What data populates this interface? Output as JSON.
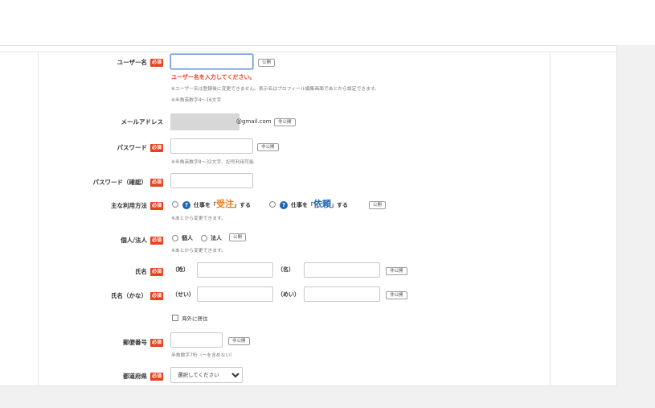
{
  "form": {
    "username": {
      "label": "ユーザー名",
      "required": "必須",
      "value": "",
      "public_tag": "公開",
      "error": "ユーザー名を入力してください。",
      "note1": "※ユーザー名は登録後に変更できません。表示名はプロフィール編集画面であとから設定できます。",
      "note2": "※半角英数字4～16文字"
    },
    "email": {
      "label": "メールアドレス",
      "suffix": "@gmail.com",
      "private_tag": "非公開"
    },
    "password": {
      "label": "パスワード",
      "required": "必須",
      "value": "",
      "private_tag": "非公開",
      "note": "※半角英数字8～32文字、記号利用可能"
    },
    "password_confirm": {
      "label": "パスワード（確認）",
      "required": "必須",
      "value": ""
    },
    "usage": {
      "label": "主な利用方法",
      "required": "必須",
      "opt1_pre": "仕事を「",
      "opt1_key": "受注",
      "opt1_post": "」する",
      "opt2_pre": "仕事を「",
      "opt2_key": "依頼",
      "opt2_post": "」する",
      "public_tag": "公開",
      "note": "※あとから変更できます。"
    },
    "entity": {
      "label": "個人/法人",
      "required": "必須",
      "opt_individual": "個人",
      "opt_corporate": "法人",
      "public_tag": "公開",
      "note": "※あとから変更できます。"
    },
    "name": {
      "label": "氏名",
      "required": "必須",
      "last_label": "（姓）",
      "first_label": "（名）",
      "private_tag": "非公開"
    },
    "name_kana": {
      "label": "氏名（かな）",
      "required": "必須",
      "last_label": "（せい）",
      "first_label": "（めい）",
      "private_tag": "非公開"
    },
    "overseas": {
      "label": "海外に居住"
    },
    "postal": {
      "label": "郵便番号",
      "required": "必須",
      "private_tag": "非公開",
      "note": "半角数字7桁（ーを含めない）"
    },
    "prefecture": {
      "label": "都道府県",
      "required": "必須",
      "selected": "選択してください"
    }
  },
  "colors": {
    "required_badge": "#e8421f",
    "error_text": "#e53d1c",
    "accent_orange": "#f07a14",
    "accent_blue": "#1e66b4",
    "focus_border": "#6c96d8"
  },
  "icons": {
    "help": "question-circle-icon",
    "dropdown": "chevron-down-icon"
  }
}
